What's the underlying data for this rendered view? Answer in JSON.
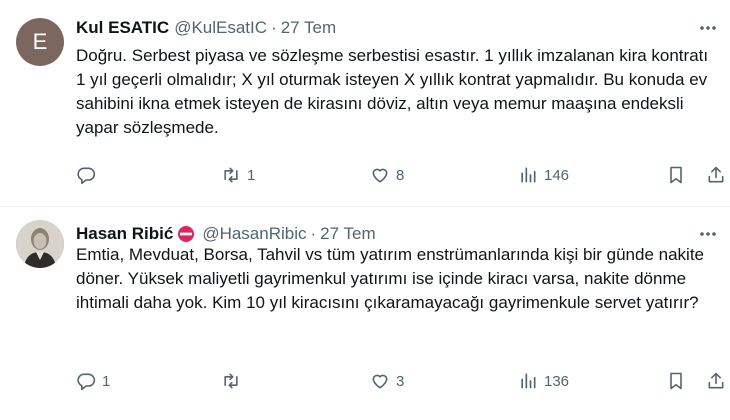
{
  "tweets": [
    {
      "avatar_letter": "E",
      "name": "Kul ESATIC",
      "handle": "@KulEsatIC",
      "separator": "·",
      "date": "27 Tem",
      "text": "Doğru. Serbest piyasa ve sözleşme serbestisi esastır. 1 yıllık imzalanan kira kontratı 1 yıl geçerli olmalıdır; X yıl oturmak isteyen X yıllık kontrat yapmalıdır. Bu konuda ev sahibini ikna etmek isteyen de kirasını döviz, altın veya memur maaşına endeksli yapar sözleşmede.",
      "replies": "",
      "retweets": "1",
      "likes": "8",
      "views": "146"
    },
    {
      "name": "Hasan Ribić",
      "handle": "@HasanRibic",
      "separator": "·",
      "date": "27 Tem",
      "text": "Emtia, Mevduat, Borsa, Tahvil vs tüm yatırım enstrümanlarında kişi bir günde nakite döner. Yüksek maliyetli gayrimenkul yatırımı ise içinde kiracı varsa, nakite dönme ihtimali daha yok. Kim 10 yıl kiracısını çıkaramayacağı gayrimenkule servet yatırır?",
      "replies": "1",
      "retweets": "",
      "likes": "3",
      "views": "136"
    }
  ],
  "colors": {
    "text_primary": "#0f1419",
    "text_secondary": "#536471",
    "divider": "#eff3f4",
    "avatar_bg": "#7b675d",
    "badge_red": "#e0245e"
  },
  "icons": {
    "more": "more-horizontal-icon",
    "reply": "reply-icon",
    "retweet": "retweet-icon",
    "like": "heart-icon",
    "views": "views-bar-icon",
    "bookmark": "bookmark-icon",
    "share": "share-icon",
    "badge": "no-entry-icon"
  }
}
